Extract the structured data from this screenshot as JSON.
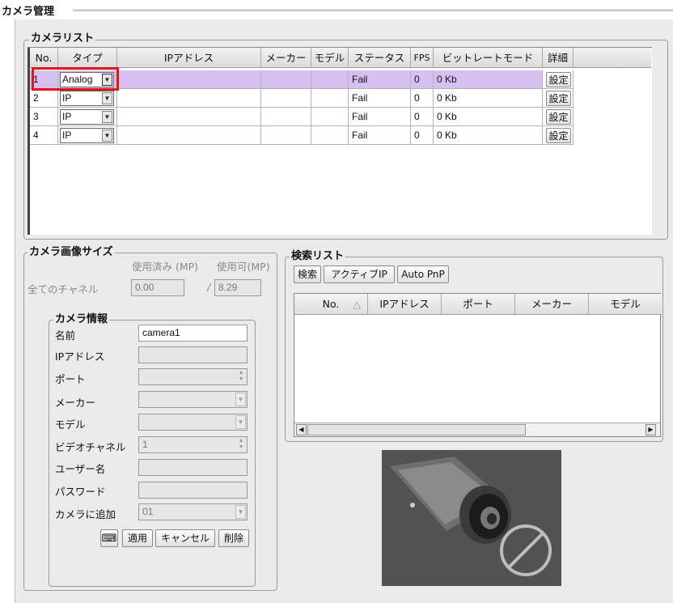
{
  "window_title": "カメラ管理",
  "camera_list": {
    "legend": "カメラリスト",
    "columns": [
      "No.",
      "タイプ",
      "IPアドレス",
      "メーカー",
      "モデル",
      "ステータス",
      "FPS",
      "ビットレートモード",
      "詳細"
    ],
    "rows": [
      {
        "no": "1",
        "type": "Analog",
        "ip": "",
        "maker": "",
        "model": "",
        "status": "Fail",
        "fps": "0",
        "bitrate": "0 Kb",
        "detail": "設定"
      },
      {
        "no": "2",
        "type": "IP",
        "ip": "",
        "maker": "",
        "model": "",
        "status": "Fail",
        "fps": "0",
        "bitrate": "0 Kb",
        "detail": "設定"
      },
      {
        "no": "3",
        "type": "IP",
        "ip": "",
        "maker": "",
        "model": "",
        "status": "Fail",
        "fps": "0",
        "bitrate": "0 Kb",
        "detail": "設定"
      },
      {
        "no": "4",
        "type": "IP",
        "ip": "",
        "maker": "",
        "model": "",
        "status": "Fail",
        "fps": "0",
        "bitrate": "0 Kb",
        "detail": "設定"
      }
    ],
    "selected_row": 1
  },
  "image_size": {
    "legend": "カメラ画像サイズ",
    "used_label": "使用済み (MP)",
    "available_label": "使用可(MP)",
    "all_channels_label": "全てのチャネル",
    "used_value": "0.00",
    "separator": "/",
    "available_value": "8.29"
  },
  "camera_info": {
    "legend": "カメラ情報",
    "name_label": "名前",
    "name_value": "camera1",
    "ip_label": "IPアドレス",
    "port_label": "ポート",
    "maker_label": "メーカー",
    "model_label": "モデル",
    "video_channel_label": "ビデオチャネル",
    "video_channel_value": "1",
    "username_label": "ユーザー名",
    "password_label": "パスワード",
    "add_to_camera_label": "カメラに追加",
    "add_to_camera_value": "01",
    "apply_button": "適用",
    "cancel_button": "キャンセル",
    "delete_button": "削除"
  },
  "search_list": {
    "legend": "検索リスト",
    "search_button": "検索",
    "active_ip_button": "アクティブIP",
    "auto_pnp_button": "Auto PnP",
    "columns": [
      "No.",
      "IPアドレス",
      "ポート",
      "メーカー",
      "モデル"
    ],
    "sort_indicator": "△"
  },
  "icons": {
    "dropdown": "chevron-down-icon",
    "keyboard": "keyboard-icon",
    "no_signal": "prohibited-icon"
  },
  "colors": {
    "selection": "#d6c0f2",
    "highlight_box": "#e0141b",
    "panel_bg": "#ebebeb"
  }
}
